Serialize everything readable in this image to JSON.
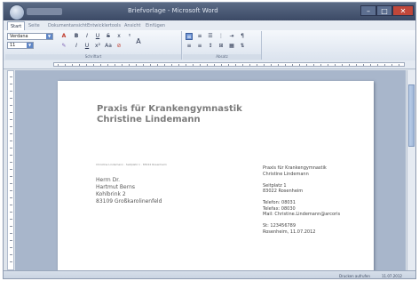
{
  "titlebar": {
    "title": "Briefvorlage - Microsoft Word",
    "minimize_glyph": "–",
    "maximize_glyph": "□",
    "close_glyph": "✕"
  },
  "tabs": [
    "Start",
    "Seite",
    "Dokumentansicht",
    "Entwicklertools",
    "Ansicht",
    "Einfügen"
  ],
  "ribbon": {
    "groups": {
      "font": "Schriftart",
      "paragraph": "Absatz"
    },
    "font_name": "Verdana",
    "font_size": "11",
    "icons": [
      "text-color-icon",
      "bold-icon",
      "italic-icon",
      "underline-icon",
      "strikethrough-icon",
      "subscript-icon",
      "superscript-icon",
      "clear-format-icon",
      "highlight-icon",
      "align-left-icon",
      "align-center-icon",
      "align-right-icon",
      "justify-icon",
      "bullets-icon",
      "line-spacing-icon",
      "paragraph-icon"
    ]
  },
  "document": {
    "title_line1": "Praxis für Krankengymnastik",
    "title_line2": "Christine Lindemann",
    "sender_line": "Christine Lindemann · Seitplatz 1 · 83022 Rosenheim",
    "recipient": [
      "Herrn Dr.",
      "Hartmut Berns",
      "Kohlbrink 2",
      "83109 Großkarolinenfeld"
    ],
    "info": [
      "Praxis für Krankengymnastik",
      "Christine Lindemann",
      "",
      "Seitplatz 1",
      "83022 Rosenheim",
      "",
      "Telefon: 08031",
      "Telefax: 08030",
      "Mail: Christine.Lindemann@arcoris",
      "",
      "St: 123456789",
      "Rosenheim, 11.07.2012"
    ]
  },
  "status": {
    "layout": "Drucken aufrufen",
    "date": "11.07.2012"
  }
}
